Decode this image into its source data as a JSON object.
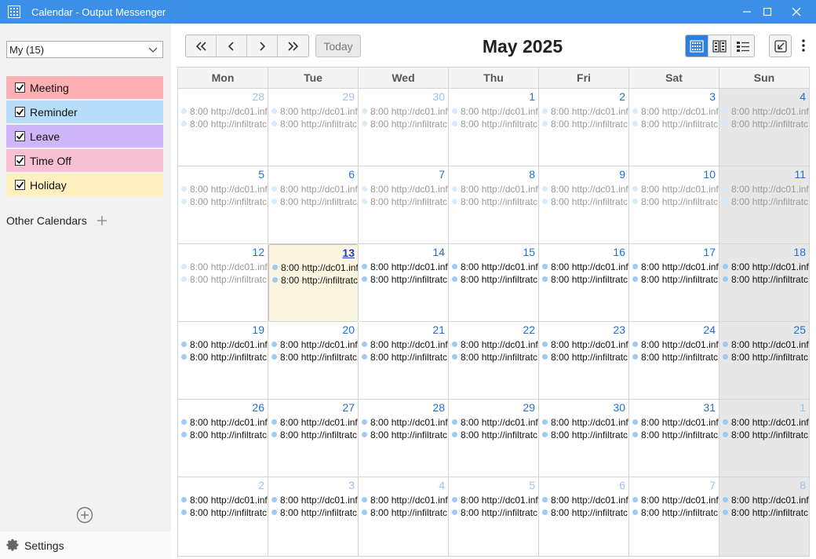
{
  "window": {
    "title": "Calendar - Output Messenger"
  },
  "sidebar": {
    "calendar_select": "My (15)",
    "calendars": [
      {
        "label": "Meeting",
        "color": "#ffb0b3",
        "checked": true
      },
      {
        "label": "Reminder",
        "color": "#b7ddfa",
        "checked": true
      },
      {
        "label": "Leave",
        "color": "#cfb6fa",
        "checked": true
      },
      {
        "label": "Time Off",
        "color": "#f9bfd2",
        "checked": true
      },
      {
        "label": "Holiday",
        "color": "#fff1bf",
        "checked": true
      }
    ],
    "other_calendars_label": "Other Calendars",
    "settings_label": "Settings"
  },
  "toolbar": {
    "today_label": "Today",
    "month_title": "May 2025"
  },
  "calendar": {
    "weekdays": [
      "Mon",
      "Tue",
      "Wed",
      "Thu",
      "Fri",
      "Sat",
      "Sun"
    ],
    "today_day": 13,
    "event_lines": [
      "8:00 http://dc01.inf",
      "8:00 http://infiltratc"
    ],
    "weeks": [
      [
        {
          "day": "28",
          "other": true,
          "past": true
        },
        {
          "day": "29",
          "other": true,
          "past": true
        },
        {
          "day": "30",
          "other": true,
          "past": true
        },
        {
          "day": "1",
          "past": true
        },
        {
          "day": "2",
          "past": true
        },
        {
          "day": "3",
          "past": true
        },
        {
          "day": "4",
          "past": true
        }
      ],
      [
        {
          "day": "5",
          "past": true
        },
        {
          "day": "6",
          "past": true
        },
        {
          "day": "7",
          "past": true
        },
        {
          "day": "8",
          "past": true
        },
        {
          "day": "9",
          "past": true
        },
        {
          "day": "10",
          "past": true
        },
        {
          "day": "11",
          "past": true
        }
      ],
      [
        {
          "day": "12",
          "past": true
        },
        {
          "day": "13",
          "today": true
        },
        {
          "day": "14"
        },
        {
          "day": "15"
        },
        {
          "day": "16"
        },
        {
          "day": "17"
        },
        {
          "day": "18"
        }
      ],
      [
        {
          "day": "19"
        },
        {
          "day": "20"
        },
        {
          "day": "21"
        },
        {
          "day": "22"
        },
        {
          "day": "23"
        },
        {
          "day": "24"
        },
        {
          "day": "25"
        }
      ],
      [
        {
          "day": "26"
        },
        {
          "day": "27"
        },
        {
          "day": "28"
        },
        {
          "day": "29"
        },
        {
          "day": "30"
        },
        {
          "day": "31"
        },
        {
          "day": "1",
          "other": true
        }
      ],
      [
        {
          "day": "2",
          "other": true
        },
        {
          "day": "3",
          "other": true
        },
        {
          "day": "4",
          "other": true
        },
        {
          "day": "5",
          "other": true
        },
        {
          "day": "6",
          "other": true
        },
        {
          "day": "7",
          "other": true
        },
        {
          "day": "8",
          "other": true
        }
      ]
    ]
  }
}
